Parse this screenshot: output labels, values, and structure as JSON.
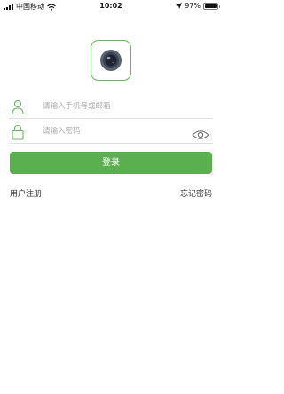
{
  "status_bar": {
    "carrier": "中国移动",
    "time": "10:02",
    "battery_percent": "97%",
    "battery_level": 0.97
  },
  "app": {
    "logo": "camera-lens-icon"
  },
  "login_form": {
    "account_placeholder": "请输入手机号或邮箱",
    "password_placeholder": "请输入密码",
    "account_icon": "user-icon",
    "password_icon": "lock-icon",
    "visibility_icon": "eye-icon",
    "submit_label": "登录"
  },
  "links": {
    "register": "用户注册",
    "forgot_password": "忘记密码"
  },
  "colors": {
    "accent": "#5aaf4e",
    "icon_green": "#62b85f"
  }
}
